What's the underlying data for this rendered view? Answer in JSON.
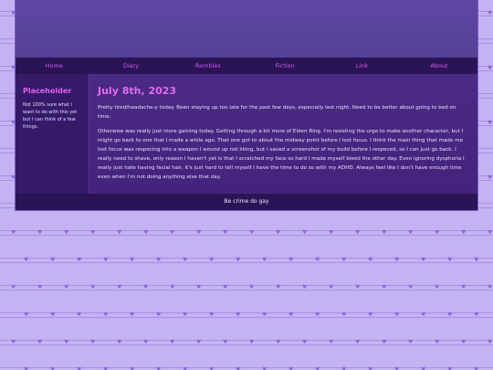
{
  "nav": {
    "items": [
      {
        "label": "Home"
      },
      {
        "label": "Diary"
      },
      {
        "label": "Rambles"
      },
      {
        "label": "Fiction"
      },
      {
        "label": "Link"
      },
      {
        "label": "About"
      }
    ]
  },
  "sidebar": {
    "title": "Placeholder",
    "text": "Not 100% sure what I want to do with this yet but I can think of a few things."
  },
  "post": {
    "title": "July 8th, 2023",
    "paragraphs": [
      "Pretty tired/headache-y today. Been staying up too late for the past few days, especially last night. Need to be better about going to bed on time.",
      "Otherwise was really just more gaming today. Getting through a bit more of Elden Ring. I'm resisting the urge to make another character, but I might go back to one that I made a while ago. That one got to about the midway point before I lost focus. I think the main thing that made me lost focus was respecing into a weapon I wound up not liking, but I saved a screenshot of my build before I respeced, so I can just go back. I really need to shave, only reason I haven't yet is that I scratched my face so hard I made myself bleed the other day. Even ignoring dysphoria I really just hate having facial hair, it's just hard to tell myself I have the time to do so with my ADHD. Always feel like I don't have enough time even when I'm not doing anything else that day."
    ]
  },
  "footer": {
    "text": "Be crime do gay"
  },
  "colors": {
    "background": "#c4b3f2",
    "panel": "#3c2270",
    "nav_bg": "#2a1456",
    "accent": "#e060f0",
    "text": "#ecdfff"
  }
}
